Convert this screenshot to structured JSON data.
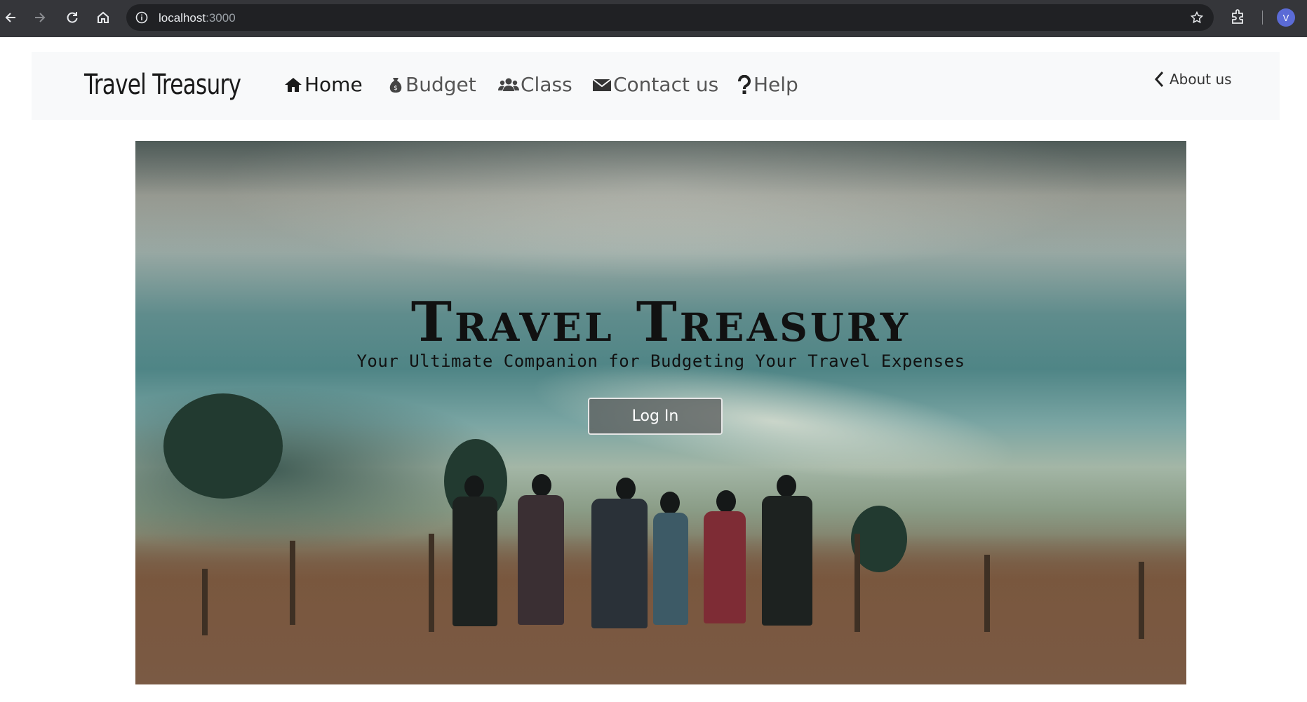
{
  "browser": {
    "url_host": "localhost",
    "url_port": ":3000",
    "profile_initial": "V",
    "icons": [
      "back-arrow-icon",
      "forward-arrow-icon",
      "reload-icon",
      "home-icon",
      "info-icon",
      "star-icon",
      "extensions-icon"
    ]
  },
  "navbar": {
    "brand": "Travel Treasury",
    "links": [
      {
        "label": "Home",
        "icon": "home-icon"
      },
      {
        "label": "Budget",
        "icon": "money-bag-icon"
      },
      {
        "label": "Class",
        "icon": "users-icon"
      },
      {
        "label": "Contact us",
        "icon": "envelope-icon"
      },
      {
        "label": "Help",
        "icon": "question-icon"
      }
    ],
    "about_label": "About us"
  },
  "hero": {
    "title": "Travel Treasury",
    "subtitle": "Your Ultimate Companion for Budgeting Your Travel Expenses",
    "login_label": "Log In"
  },
  "colors": {
    "chrome_bg": "#35363a",
    "omnibox_bg": "#202124",
    "navbar_bg": "#f8f9fa",
    "profile_bg": "#5b6bd6"
  }
}
